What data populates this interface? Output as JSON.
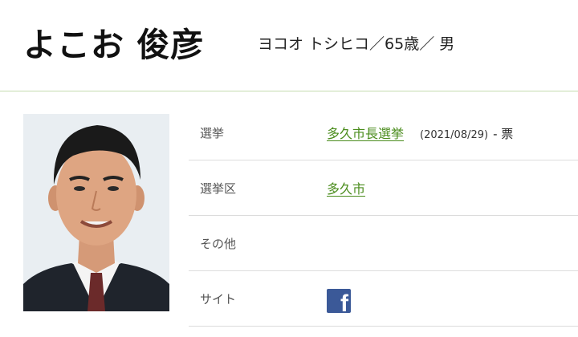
{
  "candidate": {
    "name": "よこお 俊彦",
    "kana_age_sex": "ヨコオ トシヒコ／65歳／ 男"
  },
  "info": {
    "election": {
      "label": "選挙",
      "name": "多久市長選挙",
      "date": "(2021/08/29)",
      "votes": "- 票"
    },
    "district": {
      "label": "選挙区",
      "name": "多久市"
    },
    "other": {
      "label": "その他",
      "value": ""
    },
    "site": {
      "label": "サイト",
      "icon": "facebook-icon",
      "icon_color": "#3b5998"
    }
  },
  "colors": {
    "link": "#4a8c1c",
    "header_rule": "#c5dcb0"
  }
}
